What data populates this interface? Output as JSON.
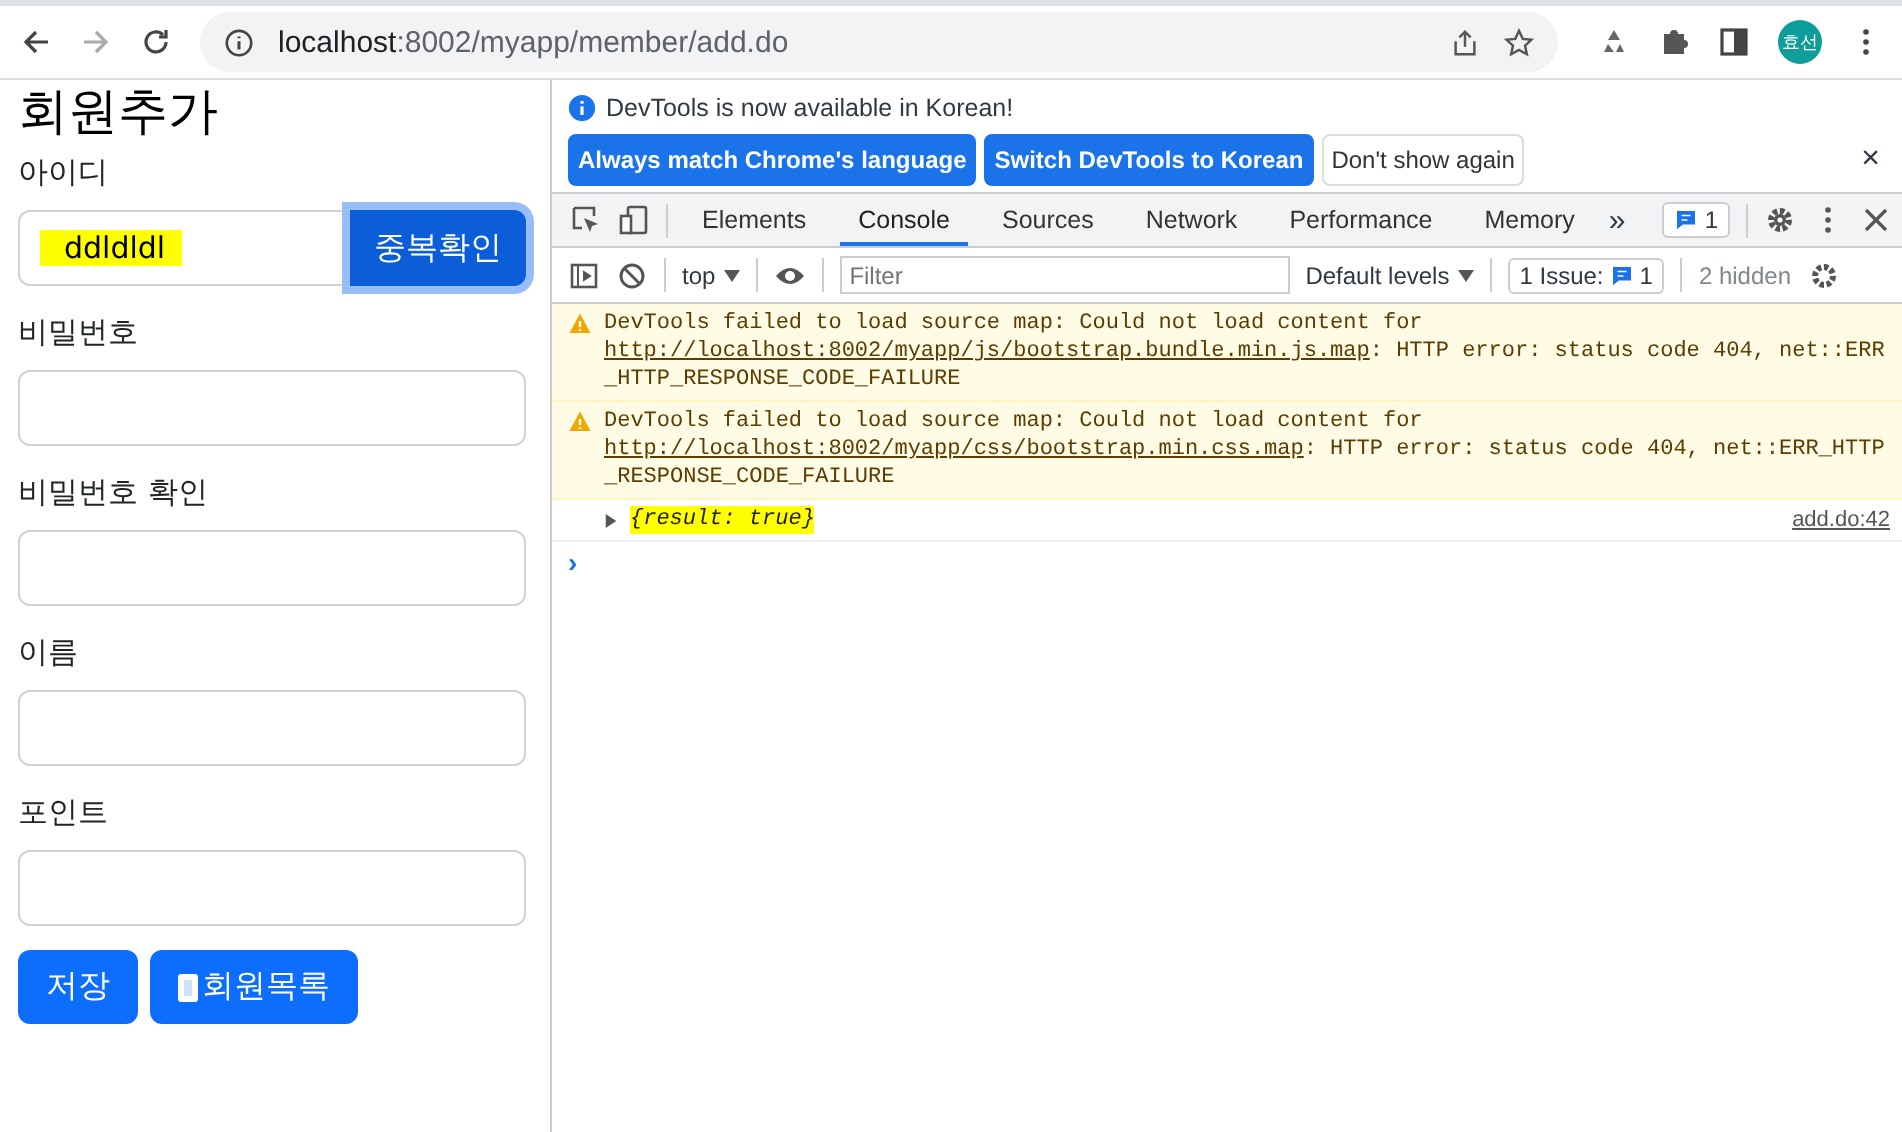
{
  "browser": {
    "url_host": "localhost",
    "url_rest": ":8002/myapp/member/add.do",
    "profile": "효선"
  },
  "page": {
    "title": "회원추가",
    "fields": [
      {
        "label": "아이디",
        "value": "ddldldl",
        "highlighted": true,
        "button": "중복확인"
      },
      {
        "label": "비밀번호"
      },
      {
        "label": "비밀번호 확인"
      },
      {
        "label": "이름"
      },
      {
        "label": "포인트"
      }
    ],
    "buttons": [
      {
        "label": "저장",
        "icon": false
      },
      {
        "label": "회원목록",
        "icon": true
      }
    ]
  },
  "devtools": {
    "infobar": {
      "message": "DevTools is now available in Korean!",
      "buttons": [
        {
          "label": "Always match Chrome's language",
          "primary": true
        },
        {
          "label": "Switch DevTools to Korean",
          "primary": true
        },
        {
          "label": "Don't show again",
          "primary": false
        }
      ],
      "close": "×"
    },
    "tabs": [
      {
        "label": "Elements",
        "selected": false
      },
      {
        "label": "Console",
        "selected": true
      },
      {
        "label": "Sources",
        "selected": false
      },
      {
        "label": "Network",
        "selected": false
      },
      {
        "label": "Performance",
        "selected": false
      },
      {
        "label": "Memory",
        "selected": false
      }
    ],
    "more": "»",
    "issues_badge": "1",
    "toolbar": {
      "context": "top",
      "filter_placeholder": "Filter",
      "levels": "Default levels",
      "issues_label": "1 Issue:",
      "issues_count": "1",
      "hidden": "2 hidden"
    },
    "messages": [
      {
        "kind": "warning",
        "prefix": "DevTools failed to load source map: Could not load content for ",
        "link": "http://localhost:8002/myapp/js/bootstrap.bundle.min.js.map",
        "suffix": ": HTTP error: status code 404, net::ERR_HTTP_RESPONSE_CODE_FAILURE"
      },
      {
        "kind": "warning",
        "prefix": "DevTools failed to load source map: Could not load content for ",
        "link": "http://localhost:8002/myapp/css/bootstrap.min.css.map",
        "suffix": ": HTTP error: status code 404, net::ERR_HTTP_RESPONSE_CODE_FAILURE"
      },
      {
        "kind": "log",
        "text": "{result: true}",
        "highlighted": true,
        "source": "add.do:42"
      }
    ],
    "prompt": "›"
  }
}
